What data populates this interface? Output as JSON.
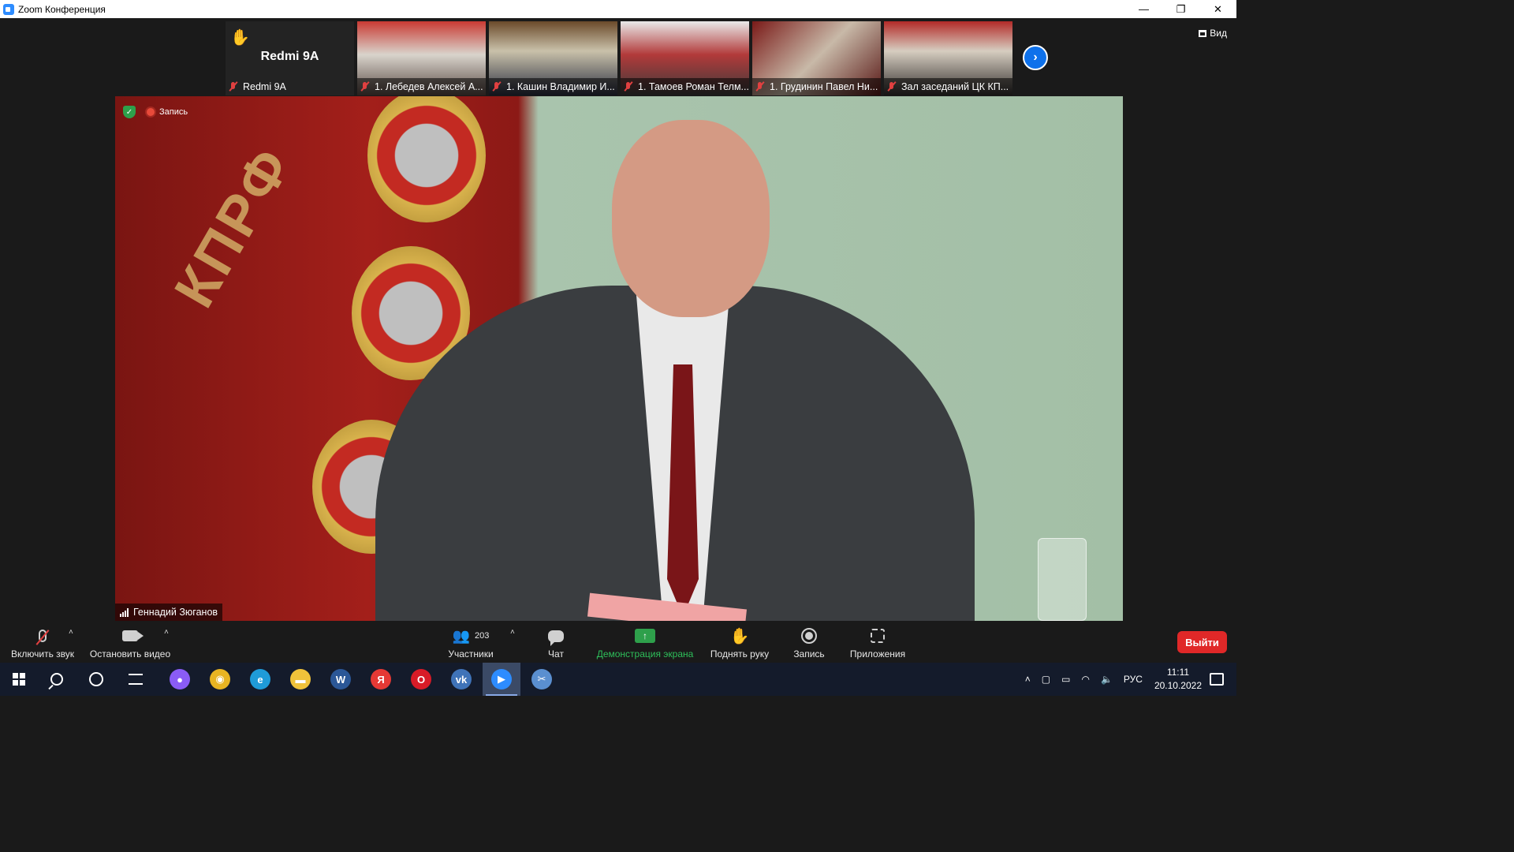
{
  "window": {
    "title": "Zoom Конференция",
    "controls": {
      "minimize": "—",
      "restore": "❐",
      "close": "✕"
    }
  },
  "strip": {
    "self": {
      "name": "Redmi 9A",
      "label": "Redmi 9A",
      "hand_icon": "raised-hand-icon"
    },
    "tiles": [
      {
        "label": "1. Лебедев Алексей А..."
      },
      {
        "label": "1. Кашин Владимир И..."
      },
      {
        "label": "1. Тамоев Роман Телм..."
      },
      {
        "label": "1. Грудинин Павел Ни..."
      },
      {
        "label": "Зал заседаний ЦК КП..."
      }
    ],
    "next_glyph": "›"
  },
  "view_button": {
    "label": "Вид"
  },
  "video": {
    "recording_label": "Запись",
    "speaker_name": "Геннадий Зюганов",
    "banner_text": "КПРФ"
  },
  "toolbar": {
    "mute_label": "Включить звук",
    "video_label": "Остановить видео",
    "participants_label": "Участники",
    "participants_count": "203",
    "chat_label": "Чат",
    "share_label": "Демонстрация экрана",
    "raise_hand_label": "Поднять руку",
    "record_label": "Запись",
    "apps_label": "Приложения",
    "leave_label": "Выйти",
    "caret": "˄"
  },
  "taskbar": {
    "apps": [
      {
        "name": "alice",
        "glyph": "●",
        "color": "#8a5cf6"
      },
      {
        "name": "chrome",
        "glyph": "◉",
        "color": "#e8b422"
      },
      {
        "name": "edge",
        "glyph": "e",
        "color": "#1f9bd8"
      },
      {
        "name": "explorer",
        "glyph": "▬",
        "color": "#f0c23a"
      },
      {
        "name": "word",
        "glyph": "W",
        "color": "#2b5797"
      },
      {
        "name": "yandex",
        "glyph": "Я",
        "color": "#e53935"
      },
      {
        "name": "opera",
        "glyph": "O",
        "color": "#d81b27"
      },
      {
        "name": "vk",
        "glyph": "vk",
        "color": "#3f73b8"
      },
      {
        "name": "zoom",
        "glyph": "▶",
        "color": "#2d8cff"
      },
      {
        "name": "snipping",
        "glyph": "✂",
        "color": "#5a8fd0"
      }
    ],
    "lang": "РУС",
    "time": "11:11",
    "date": "20.10.2022"
  },
  "colors": {
    "accent": "#0e71eb",
    "leave": "#e02828",
    "share": "#2ea04b",
    "taskbar": "#141b2b"
  }
}
